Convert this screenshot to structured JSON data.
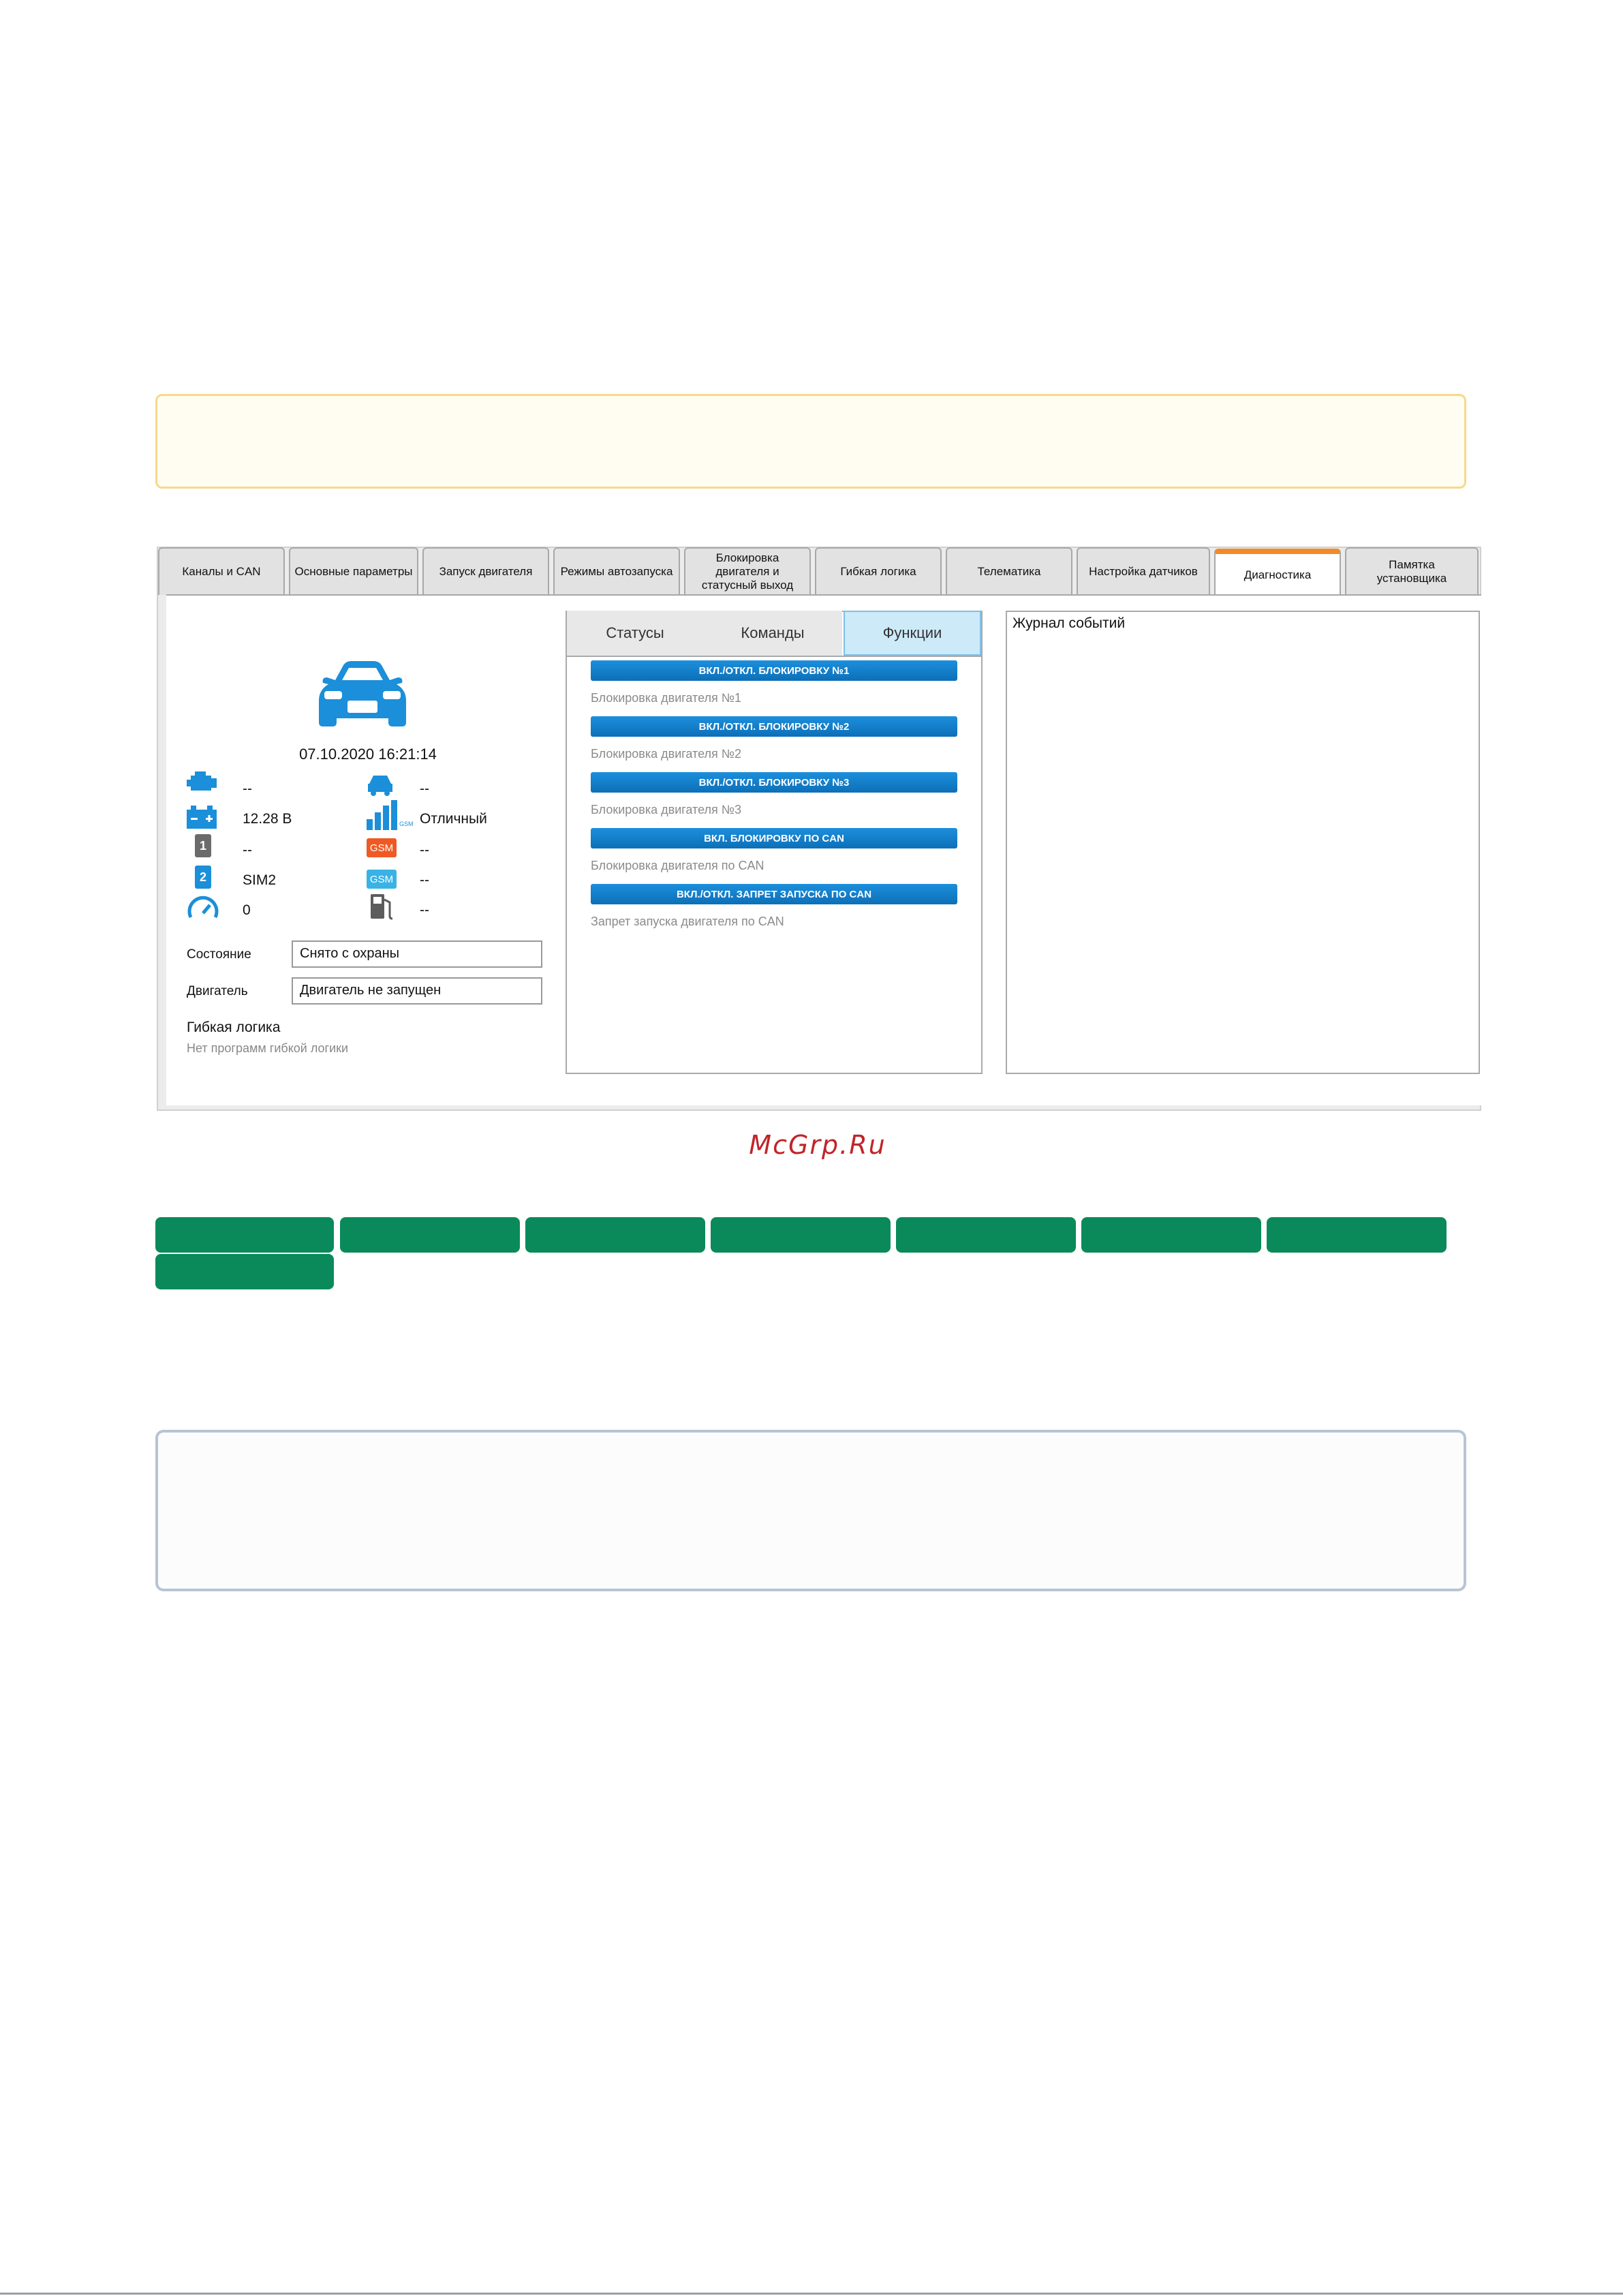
{
  "tabs": [
    {
      "label": "Каналы и CAN"
    },
    {
      "label": "Основные параметры"
    },
    {
      "label": "Запуск двигателя"
    },
    {
      "label": "Режимы автозапуска"
    },
    {
      "label": "Блокировка\nдвигателя и\nстатусный выход"
    },
    {
      "label": "Гибкая логика"
    },
    {
      "label": "Телематика"
    },
    {
      "label": "Настройка датчиков"
    },
    {
      "label": "Диагностика"
    },
    {
      "label": "Памятка\nустановщика"
    }
  ],
  "active_tab": "Диагностика",
  "status": {
    "datetime": "07.10.2020  16:21:14",
    "engine_value": "--",
    "car_value": "--",
    "battery_value": "12.28 В",
    "signal_value": "Отличный",
    "sim1_value": "--",
    "gsm1_value": "--",
    "sim2_value": "SIM2",
    "gsm2_value": "--",
    "speed_value": "0",
    "fuel_value": "--",
    "sim1_icon_label": "1",
    "sim2_icon_label": "2",
    "gsm_icon_label": "GSM",
    "signal_icon_label": "GSM"
  },
  "fields": {
    "state_label": "Состояние",
    "state_value": "Снято с охраны",
    "engine_label": "Двигатель",
    "engine_value": "Двигатель не запущен"
  },
  "flex_logic": {
    "title": "Гибкая логика",
    "empty": "Нет программ гибкой логики"
  },
  "subtabs": [
    "Статусы",
    "Команды",
    "Функции"
  ],
  "active_subtab": "Функции",
  "functions": [
    {
      "button": "ВКЛ./ОТКЛ. БЛОКИРОВКУ №1",
      "desc": "Блокировка двигателя №1"
    },
    {
      "button": "ВКЛ./ОТКЛ. БЛОКИРОВКУ №2",
      "desc": "Блокировка двигателя №2"
    },
    {
      "button": "ВКЛ./ОТКЛ. БЛОКИРОВКУ №3",
      "desc": "Блокировка двигателя №3"
    },
    {
      "button": "ВКЛ. БЛОКИРОВКУ ПО CAN",
      "desc": "Блокировка двигателя по CAN"
    },
    {
      "button": "ВКЛ./ОТКЛ. ЗАПРЕТ ЗАПУСКА ПО CAN",
      "desc": "Запрет запуска двигателя по CAN"
    }
  ],
  "log": {
    "title": "Журнал событий"
  },
  "watermark": "McGrp.Ru",
  "colors": {
    "accent_blue": "#1b8fd9",
    "active_tab_orange": "#f08a2c",
    "green_buttons": "#0a8a5a",
    "watermark_red": "#c0252a"
  }
}
